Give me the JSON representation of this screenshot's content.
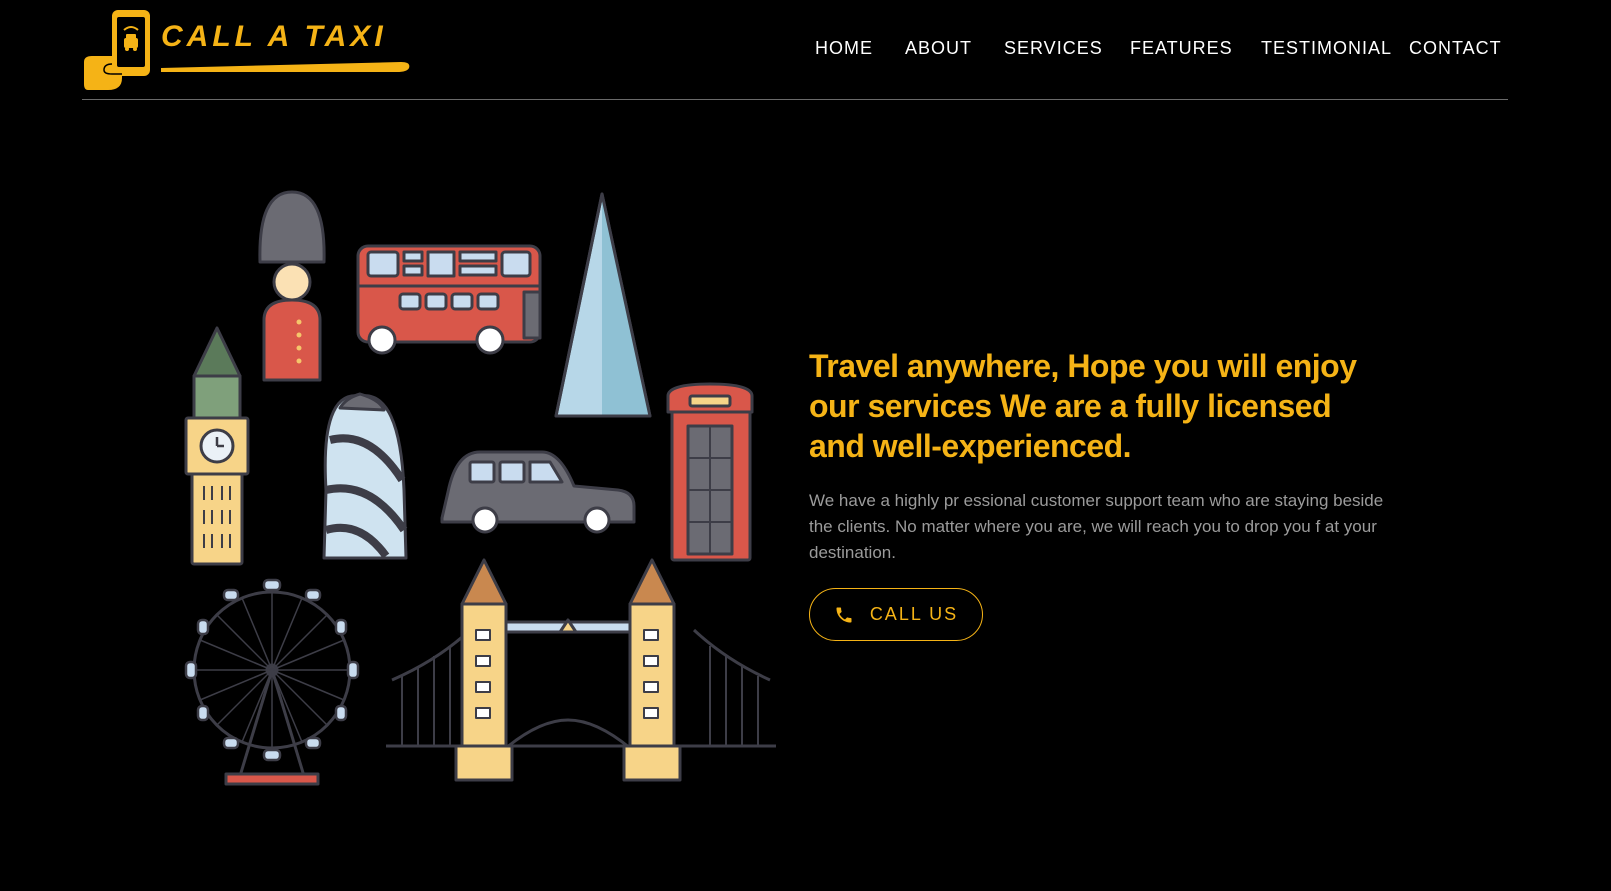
{
  "brand": {
    "name": "CALL A TAXI",
    "accent": "#f5b316"
  },
  "nav": {
    "items": [
      "HOME",
      "ABOUT",
      "SERVICES",
      "FEATURES",
      "TESTIMONIAL",
      "CONTACT"
    ]
  },
  "hero": {
    "headline": "Travel anywhere, Hope you will enjoy our services We are a fully licensed and well-experienced.",
    "description": "We have a highly pr essional customer support team who are staying beside the clients. No matter where you are, we will reach you to drop you f at your destination.",
    "cta_label": "CALL US",
    "cta_icon": "phone-icon"
  },
  "illustration": {
    "icons": [
      "royal-guard-icon",
      "double-decker-bus-icon",
      "shard-tower-icon",
      "big-ben-icon",
      "gherkin-icon",
      "black-cab-icon",
      "phone-box-icon",
      "london-eye-icon",
      "tower-bridge-icon"
    ]
  }
}
